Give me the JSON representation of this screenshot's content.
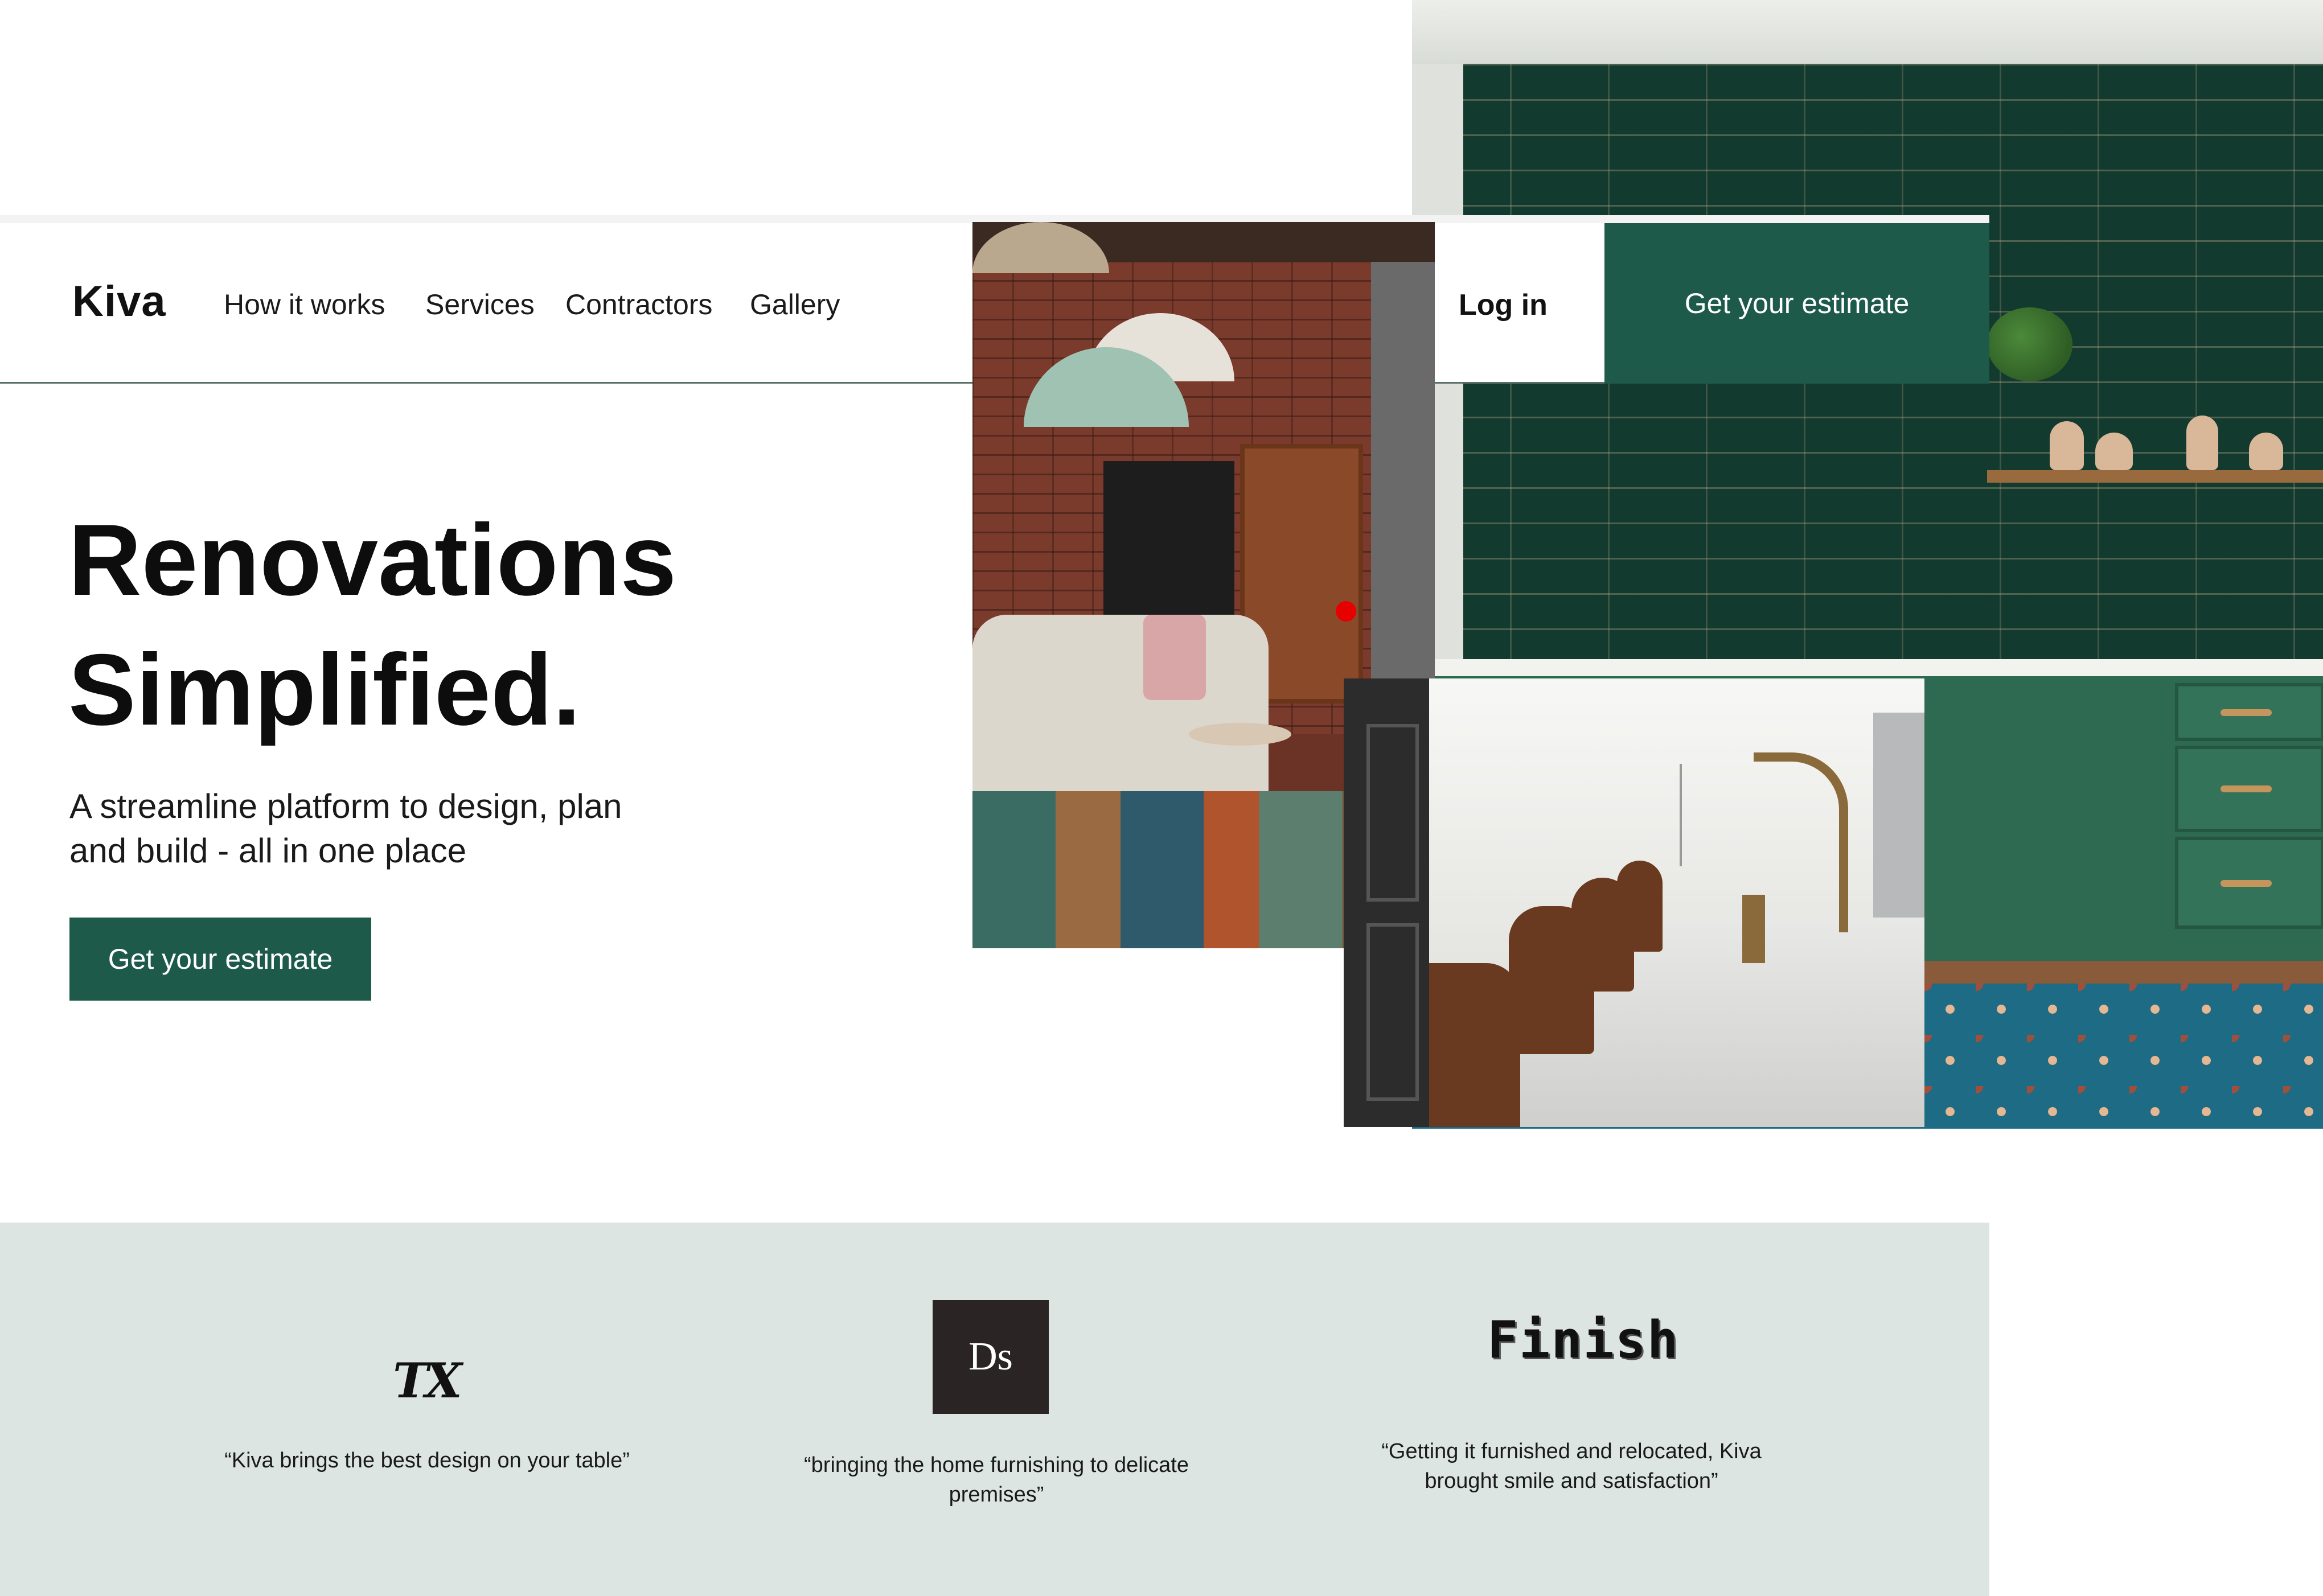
{
  "brand": {
    "name": "Kiva",
    "accent_color": "#1e5a4a",
    "band_color": "#dce5e2"
  },
  "nav": {
    "items": [
      {
        "label": "How it works"
      },
      {
        "label": "Services"
      },
      {
        "label": "Contractors"
      },
      {
        "label": "Gallery"
      }
    ],
    "login_label": "Log in",
    "cta_label": "Get your estimate"
  },
  "hero": {
    "title_line1": "Renovations",
    "title_line2": "Simplified.",
    "subtitle_line1": "A streamline platform to design, plan",
    "subtitle_line2": "and build - all in one place",
    "cta_label": "Get your estimate"
  },
  "testimonials": [
    {
      "logo_text": "TX",
      "quote": "“Kiva brings the best design on your table”"
    },
    {
      "logo_text": "Ds",
      "quote_line1": "“bringing the home furnishing to delicate",
      "quote_line2": "premises”"
    },
    {
      "logo_text": "Finish",
      "quote_line1": "“Getting it furnished and relocated, Kiva",
      "quote_line2": "brought smile and satisfaction”"
    }
  ],
  "images": [
    {
      "name": "kitchen-green-tile-photo"
    },
    {
      "name": "living-room-photo"
    },
    {
      "name": "modern-kitchen-photo"
    }
  ]
}
